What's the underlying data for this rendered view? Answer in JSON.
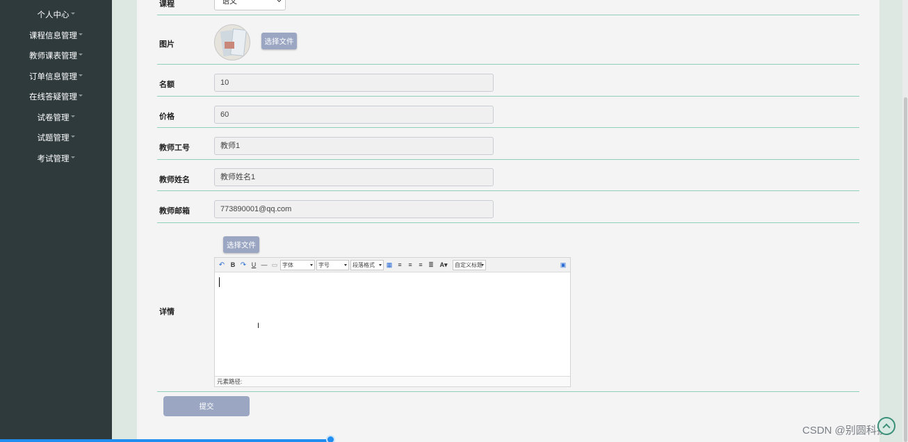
{
  "sidebar": {
    "items": [
      {
        "label": "个人中心"
      },
      {
        "label": "课程信息管理"
      },
      {
        "label": "教师课表管理"
      },
      {
        "label": "订单信息管理"
      },
      {
        "label": "在线答疑管理"
      },
      {
        "label": "试卷管理"
      },
      {
        "label": "试题管理"
      },
      {
        "label": "考试管理"
      }
    ]
  },
  "form": {
    "course": {
      "label": "课程",
      "value": "语文"
    },
    "image": {
      "label": "图片",
      "button": "选择文件"
    },
    "quota": {
      "label": "名额",
      "value": "10"
    },
    "price": {
      "label": "价格",
      "value": "60"
    },
    "teacher_id": {
      "label": "教师工号",
      "value": "教师1"
    },
    "teacher_name": {
      "label": "教师姓名",
      "value": "教师姓名1"
    },
    "teacher_email": {
      "label": "教师邮箱",
      "value": "773890001@qq.com"
    },
    "detail": {
      "label": "详情",
      "button": "选择文件",
      "toolbar": {
        "font": "字体",
        "size": "字号",
        "paragraph": "段落格式",
        "custom": "自定义标题"
      },
      "element_path": "元素路径:"
    },
    "submit": "提交"
  },
  "watermark": "CSDN @别圆科技",
  "colors": {
    "sidebar_bg": "#2f3a3d",
    "divider": "#8fd0bd",
    "button": "#9aa6c2",
    "progress": "#1f8ef0"
  },
  "progress": {
    "fraction": 0.364
  }
}
